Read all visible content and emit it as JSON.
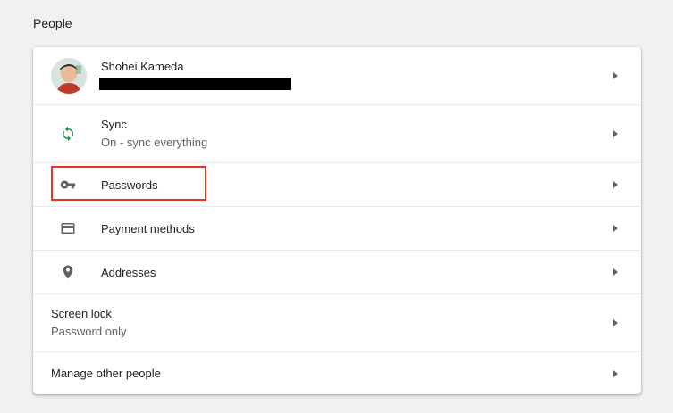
{
  "section": {
    "title": "People"
  },
  "account": {
    "name": "Shohei Kameda",
    "email_redacted": ""
  },
  "rows": {
    "sync": {
      "label": "Sync",
      "sublabel": "On - sync everything",
      "icon": "sync-icon"
    },
    "passwords": {
      "label": "Passwords",
      "icon": "key-icon"
    },
    "payment": {
      "label": "Payment methods",
      "icon": "credit-card-icon"
    },
    "addresses": {
      "label": "Addresses",
      "icon": "location-pin-icon"
    },
    "screen_lock": {
      "label": "Screen lock",
      "sublabel": "Password only"
    },
    "manage_people": {
      "label": "Manage other people"
    }
  },
  "colors": {
    "sync_green": "#1e8e3e",
    "highlight_red": "#e8341c",
    "icon_gray": "#5f6368"
  }
}
